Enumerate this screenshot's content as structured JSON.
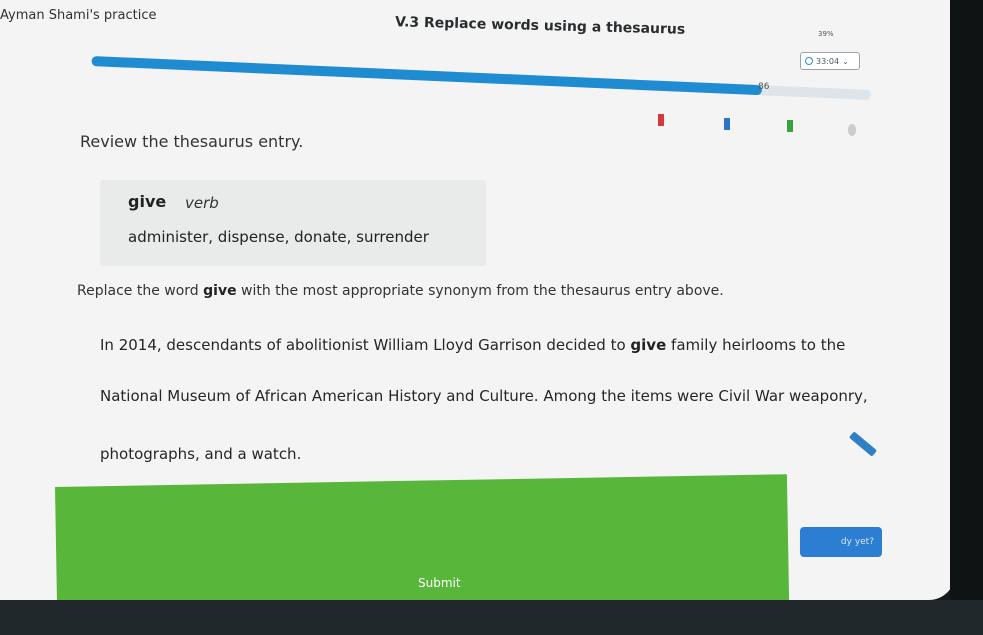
{
  "header": {
    "title": "Ayman Shami's practice",
    "practice_name": "V.3 Replace words using a thesaurus",
    "status": "39%",
    "timer": "33:04"
  },
  "progress": {
    "score": "86",
    "fill_fraction": 0.86
  },
  "question": {
    "instruction": "Review the thesaurus entry.",
    "entry": {
      "word": "give",
      "part_of_speech": "verb",
      "synonyms": "administer, dispense, donate, surrender"
    },
    "prompt_before": "Replace the word ",
    "prompt_word": "give",
    "prompt_after": " with the most appropriate synonym from the thesaurus entry above.",
    "passage": {
      "line1_before": "In 2014, descendants of abolitionist William Lloyd Garrison decided to ",
      "line1_word": "give",
      "line1_after": " family heirlooms to the",
      "line2": "National Museum of African American History and Culture. Among the items were Civil War weaponry,",
      "line3": "photographs, and a watch."
    }
  },
  "actions": {
    "submit_label": "Submit",
    "ready_label": "dy yet?"
  },
  "colors": {
    "accent_blue": "#1f8bd1",
    "submit_green": "#58b63a"
  }
}
